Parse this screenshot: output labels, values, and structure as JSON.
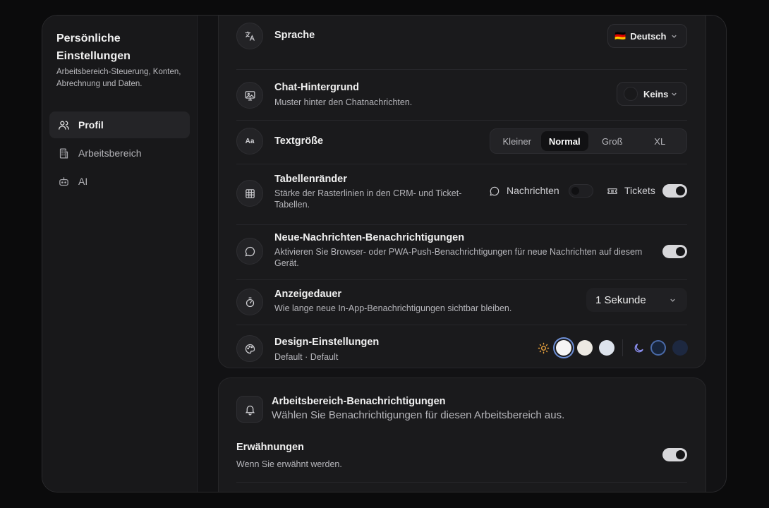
{
  "sidebar": {
    "title": "Persönliche Einstellungen",
    "subtitle": "Arbeitsbereich-Steuerung, Konten, Abrechnung und Daten.",
    "items": [
      {
        "label": "Profil",
        "icon": "users-icon",
        "active": true
      },
      {
        "label": "Arbeitsbereich",
        "icon": "building-icon",
        "active": false
      },
      {
        "label": "AI",
        "icon": "bot-icon",
        "active": false
      }
    ]
  },
  "settings": {
    "language": {
      "label": "Sprache",
      "value": "Deutsch",
      "flag": "🇩🇪",
      "icon": "translate-icon"
    },
    "chat_bg": {
      "label": "Chat-Hintergrund",
      "desc": "Muster hinter den Chatnachrichten.",
      "value": "Keins",
      "icon": "image-icon"
    },
    "text_size": {
      "label": "Textgröße",
      "icon": "text-size-icon",
      "options": [
        "Kleiner",
        "Normal",
        "Groß",
        "XL"
      ],
      "selected": "Normal"
    },
    "table_borders": {
      "label": "Tabellenränder",
      "desc": "Stärke der Rasterlinien in den CRM- und Ticket-Tabellen.",
      "icon": "grid-icon",
      "messages_label": "Nachrichten",
      "messages_on": false,
      "tickets_label": "Tickets",
      "tickets_on": true
    },
    "new_messages": {
      "label": "Neue-Nachrichten-Benachrichtigungen",
      "desc": "Aktivieren Sie Browser- oder PWA-Push-Benachrichtigungen für neue Nachrichten auf diesem Gerät.",
      "icon": "message-icon",
      "on": true
    },
    "display_duration": {
      "label": "Anzeigedauer",
      "desc": "Wie lange neue In-App-Benachrichtigungen sichtbar bleiben.",
      "value": "1 Sekunde",
      "icon": "timer-icon"
    },
    "design": {
      "label": "Design-Einstellungen",
      "desc": "Default · Default",
      "icon": "palette-icon",
      "light_swatches": [
        "#f5f5f5",
        "#ece9e2",
        "#dde3ec"
      ],
      "dark_swatches": [
        "#17243a",
        "#1d2840"
      ]
    }
  },
  "workspace_notifications": {
    "title": "Arbeitsbereich-Benachrichtigungen",
    "subtitle": "Wählen Sie Benachrichtigungen für diesen Arbeitsbereich aus.",
    "icon": "bell-icon",
    "mentions": {
      "label": "Erwähnungen",
      "desc": "Wenn Sie erwähnt werden.",
      "on": true
    }
  },
  "colors": {
    "accent_sun": "#e8a13c",
    "accent_moon": "#8b8ff0"
  }
}
